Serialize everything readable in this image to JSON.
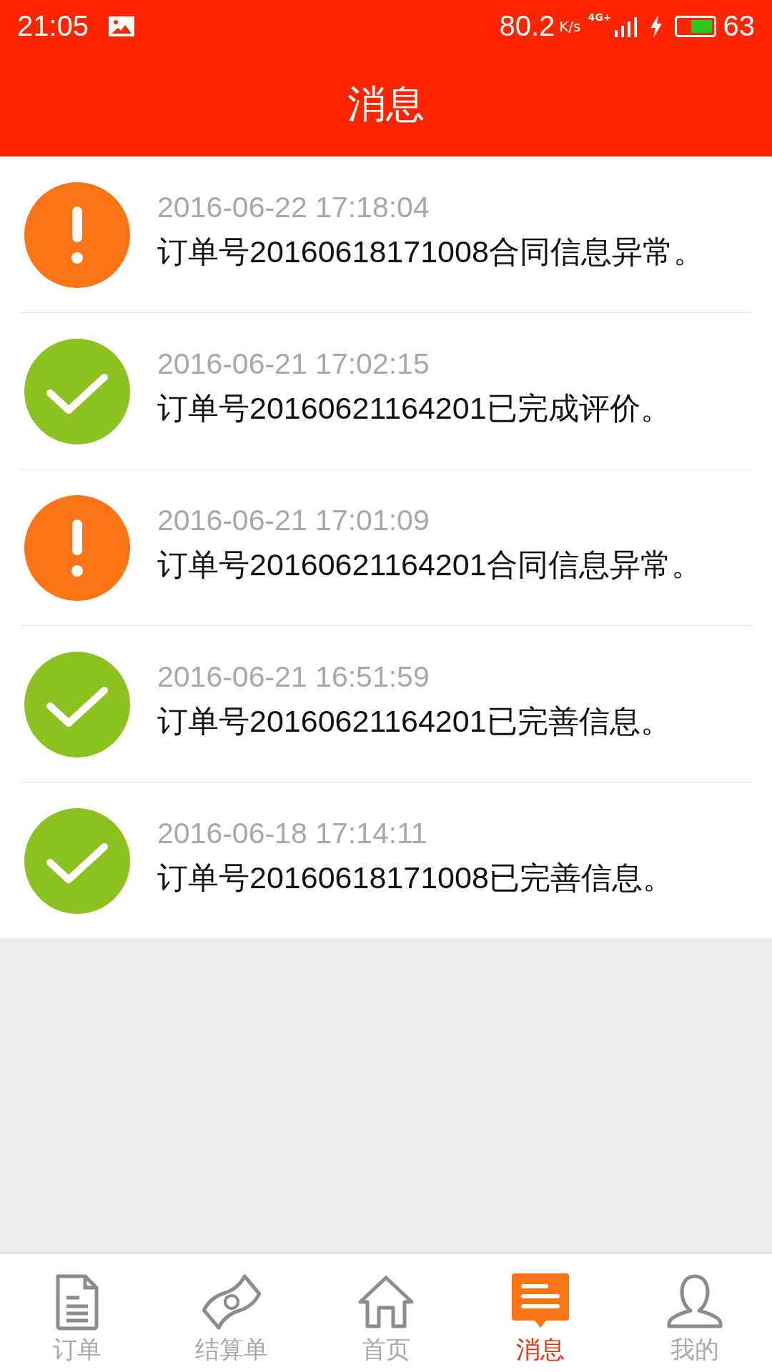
{
  "status_bar": {
    "time": "21:05",
    "speed": "80.2",
    "speed_unit": "K/s",
    "network": "4G+",
    "battery": {
      "level": 0.63,
      "text": "63"
    }
  },
  "header": {
    "title": "消息"
  },
  "messages": [
    {
      "kind": "warning",
      "time": "2016-06-22 17:18:04",
      "text": "订单号20160618171008合同信息异常。"
    },
    {
      "kind": "success",
      "time": "2016-06-21 17:02:15",
      "text": "订单号20160621164201已完成评价。"
    },
    {
      "kind": "warning",
      "time": "2016-06-21 17:01:09",
      "text": "订单号20160621164201合同信息异常。"
    },
    {
      "kind": "success",
      "time": "2016-06-21 16:51:59",
      "text": "订单号20160621164201已完善信息。"
    },
    {
      "kind": "success",
      "time": "2016-06-18 17:14:11",
      "text": "订单号20160618171008已完善信息。"
    }
  ],
  "tab_bar": [
    {
      "kind": "orders",
      "label": "订单",
      "selected": false
    },
    {
      "kind": "bill",
      "label": "结算单",
      "selected": false
    },
    {
      "kind": "home",
      "label": "首页",
      "selected": false
    },
    {
      "kind": "messages",
      "label": "消息",
      "selected": true
    },
    {
      "kind": "profile",
      "label": "我的",
      "selected": false
    }
  ]
}
